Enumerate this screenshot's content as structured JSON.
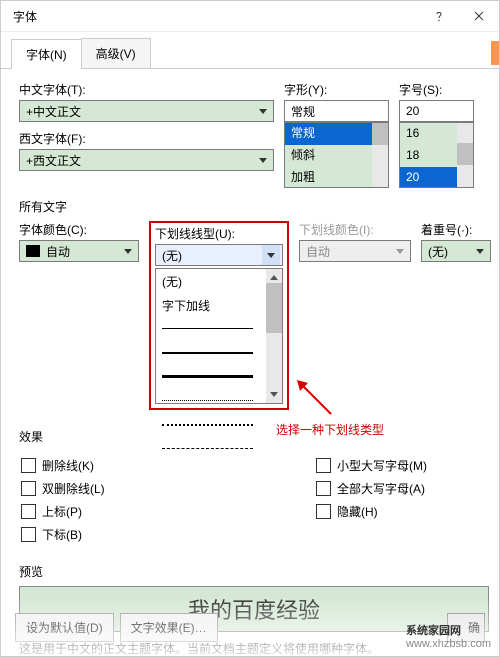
{
  "window": {
    "title": "字体"
  },
  "tabs": {
    "font": "字体(N)",
    "advanced": "高级(V)"
  },
  "labels": {
    "chinese_font": "中文字体(T):",
    "western_font": "西文字体(F):",
    "style": "字形(Y):",
    "size": "字号(S):",
    "all_text": "所有文字",
    "font_color": "字体颜色(C):",
    "underline_style": "下划线线型(U):",
    "underline_color": "下划线颜色(I):",
    "emphasis": "着重号(·):",
    "effects": "效果",
    "preview": "预览"
  },
  "fields": {
    "chinese_font_value": "+中文正文",
    "western_font_value": "+西文正文",
    "style_value": "常规",
    "size_value": "20",
    "font_color_value": "自动",
    "underline_style_value": "(无)",
    "underline_color_value": "自动",
    "emphasis_value": "(无)"
  },
  "style_options": [
    "常规",
    "倾斜",
    "加粗"
  ],
  "size_options": [
    "16",
    "18",
    "20"
  ],
  "underline_options": {
    "none": "(无)",
    "wordsonly": "字下加线"
  },
  "checks": {
    "strike": "删除线(K)",
    "dblstrike": "双删除线(L)",
    "superscript": "上标(P)",
    "subscript": "下标(B)",
    "smallcaps": "小型大写字母(M)",
    "allcaps": "全部大写字母(A)",
    "hidden": "隐藏(H)"
  },
  "preview_text": "我的百度经验",
  "desc_text": "这是用于中文的正文主题字体。当前文档主题定义将使用哪种字体。",
  "buttons": {
    "default": "设为默认值(D)",
    "text_effects": "文字效果(E)…",
    "ok": "确"
  },
  "annotation": "选择一种下划线类型",
  "watermark_cn": "系统家园网",
  "watermark_url": "www.xhzbsb.com"
}
